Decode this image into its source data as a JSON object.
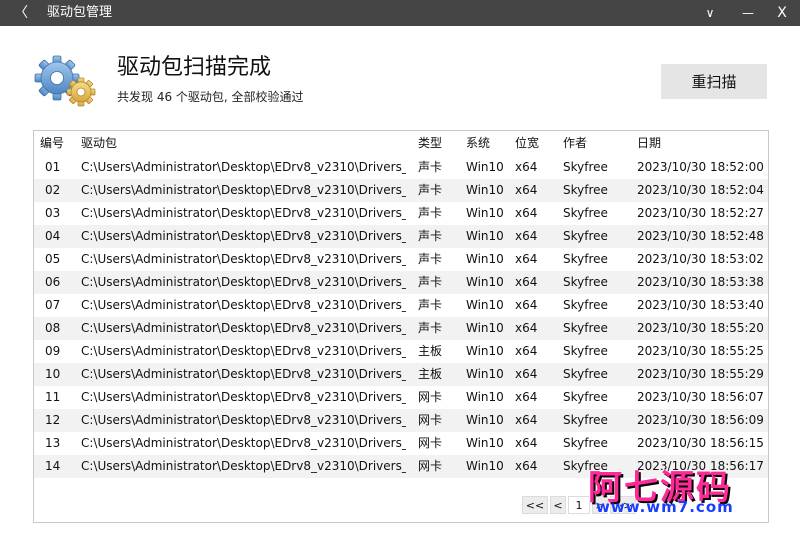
{
  "titlebar": {
    "back_glyph": "〈",
    "title": "驱动包管理",
    "menu_glyph": "∨",
    "min_glyph": "—",
    "close_glyph": "X"
  },
  "header": {
    "title": "驱动包扫描完成",
    "subtitle": "共发现 46 个驱动包, 全部校验通过",
    "rescan_label": "重扫描"
  },
  "table": {
    "columns": [
      "编号",
      "驱动包",
      "类型",
      "系统",
      "位宽",
      "作者",
      "日期"
    ],
    "rows": [
      {
        "num": "01",
        "pkg": "C:\\Users\\Administrator\\Desktop\\EDrv8_v2310\\Drivers_",
        "type": "声卡",
        "sys": "Win10",
        "bit": "x64",
        "author": "Skyfree",
        "date": "2023/10/30 18:52:00"
      },
      {
        "num": "02",
        "pkg": "C:\\Users\\Administrator\\Desktop\\EDrv8_v2310\\Drivers_",
        "type": "声卡",
        "sys": "Win10",
        "bit": "x64",
        "author": "Skyfree",
        "date": "2023/10/30 18:52:04"
      },
      {
        "num": "03",
        "pkg": "C:\\Users\\Administrator\\Desktop\\EDrv8_v2310\\Drivers_",
        "type": "声卡",
        "sys": "Win10",
        "bit": "x64",
        "author": "Skyfree",
        "date": "2023/10/30 18:52:27"
      },
      {
        "num": "04",
        "pkg": "C:\\Users\\Administrator\\Desktop\\EDrv8_v2310\\Drivers_",
        "type": "声卡",
        "sys": "Win10",
        "bit": "x64",
        "author": "Skyfree",
        "date": "2023/10/30 18:52:48"
      },
      {
        "num": "05",
        "pkg": "C:\\Users\\Administrator\\Desktop\\EDrv8_v2310\\Drivers_",
        "type": "声卡",
        "sys": "Win10",
        "bit": "x64",
        "author": "Skyfree",
        "date": "2023/10/30 18:53:02"
      },
      {
        "num": "06",
        "pkg": "C:\\Users\\Administrator\\Desktop\\EDrv8_v2310\\Drivers_",
        "type": "声卡",
        "sys": "Win10",
        "bit": "x64",
        "author": "Skyfree",
        "date": "2023/10/30 18:53:38"
      },
      {
        "num": "07",
        "pkg": "C:\\Users\\Administrator\\Desktop\\EDrv8_v2310\\Drivers_",
        "type": "声卡",
        "sys": "Win10",
        "bit": "x64",
        "author": "Skyfree",
        "date": "2023/10/30 18:53:40"
      },
      {
        "num": "08",
        "pkg": "C:\\Users\\Administrator\\Desktop\\EDrv8_v2310\\Drivers_",
        "type": "声卡",
        "sys": "Win10",
        "bit": "x64",
        "author": "Skyfree",
        "date": "2023/10/30 18:55:20"
      },
      {
        "num": "09",
        "pkg": "C:\\Users\\Administrator\\Desktop\\EDrv8_v2310\\Drivers_",
        "type": "主板",
        "sys": "Win10",
        "bit": "x64",
        "author": "Skyfree",
        "date": "2023/10/30 18:55:25"
      },
      {
        "num": "10",
        "pkg": "C:\\Users\\Administrator\\Desktop\\EDrv8_v2310\\Drivers_",
        "type": "主板",
        "sys": "Win10",
        "bit": "x64",
        "author": "Skyfree",
        "date": "2023/10/30 18:55:29"
      },
      {
        "num": "11",
        "pkg": "C:\\Users\\Administrator\\Desktop\\EDrv8_v2310\\Drivers_",
        "type": "网卡",
        "sys": "Win10",
        "bit": "x64",
        "author": "Skyfree",
        "date": "2023/10/30 18:56:07"
      },
      {
        "num": "12",
        "pkg": "C:\\Users\\Administrator\\Desktop\\EDrv8_v2310\\Drivers_",
        "type": "网卡",
        "sys": "Win10",
        "bit": "x64",
        "author": "Skyfree",
        "date": "2023/10/30 18:56:09"
      },
      {
        "num": "13",
        "pkg": "C:\\Users\\Administrator\\Desktop\\EDrv8_v2310\\Drivers_",
        "type": "网卡",
        "sys": "Win10",
        "bit": "x64",
        "author": "Skyfree",
        "date": "2023/10/30 18:56:15"
      },
      {
        "num": "14",
        "pkg": "C:\\Users\\Administrator\\Desktop\\EDrv8_v2310\\Drivers_",
        "type": "网卡",
        "sys": "Win10",
        "bit": "x64",
        "author": "Skyfree",
        "date": "2023/10/30 18:56:17"
      }
    ]
  },
  "pager": {
    "first_label": "<<",
    "prev_label": "<",
    "current_page": "1",
    "next_label": ">",
    "last_label": ">>"
  },
  "watermark": {
    "big_text": "阿七源码",
    "url_text": "www.wm7.com"
  },
  "icons": {
    "logo": "gears-icon"
  },
  "colors": {
    "titlebar_bg": "#454545",
    "row_alt_bg": "#f2f2f2",
    "button_bg": "#e5e5e5",
    "watermark_pink": "#ff2a9a",
    "watermark_blue": "#1a3cff"
  }
}
